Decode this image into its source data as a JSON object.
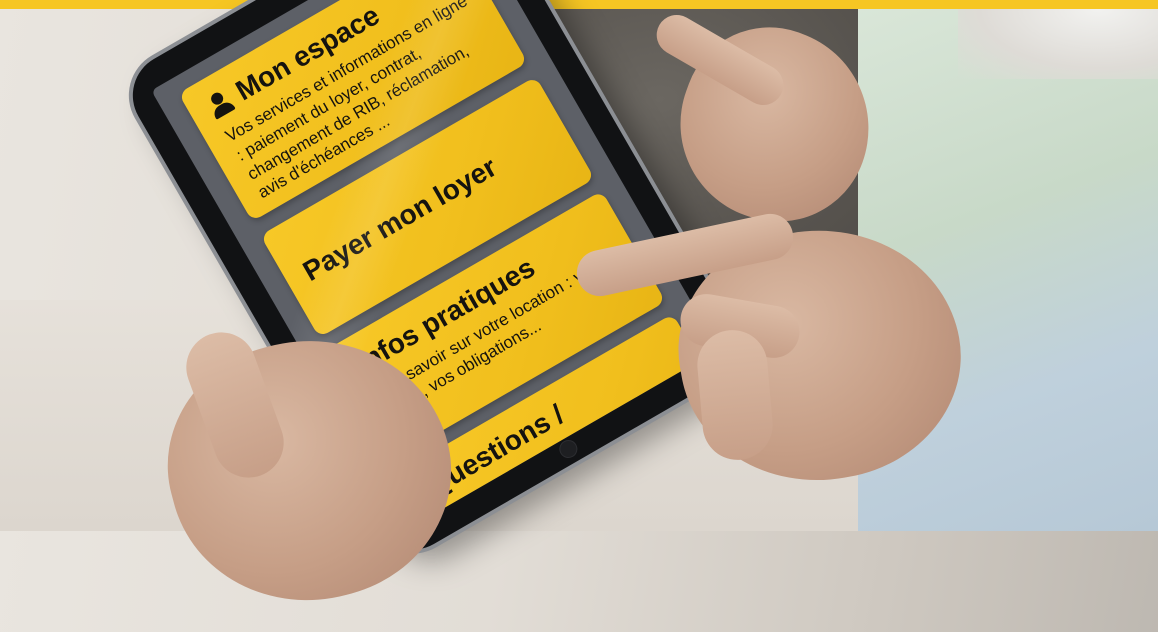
{
  "colors": {
    "accent": "#f6c623",
    "card": "#f1bf1d",
    "screen_bg": "#5d6067"
  },
  "cards": [
    {
      "icon": "user-icon",
      "title": "Mon espace",
      "description": "Vos services et informations en ligne : paiement du loyer, contrat, changement de RIB, réclamation, avis d'échéances ..."
    },
    {
      "title": "Payer mon loyer"
    },
    {
      "title": "Infos pratiques",
      "description": "Tout savoir sur votre location : vos droits, vos obligations..."
    },
    {
      "title": "Questions /"
    }
  ]
}
